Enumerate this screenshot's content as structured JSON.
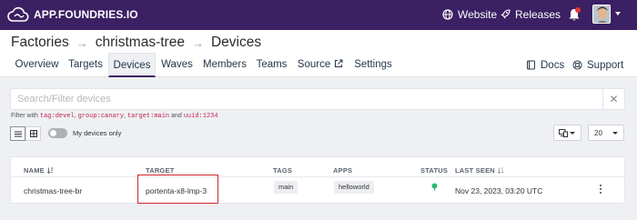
{
  "topbar": {
    "brand": "APP.FOUNDRIES.IO",
    "website_label": "Website",
    "releases_label": "Releases"
  },
  "breadcrumb": {
    "factories": "Factories",
    "factory": "christmas-tree",
    "current": "Devices"
  },
  "tabs": [
    "Overview",
    "Targets",
    "Devices",
    "Waves",
    "Members",
    "Teams",
    "Source",
    "Settings"
  ],
  "active_tab": "Devices",
  "header_links": {
    "docs": "Docs",
    "support": "Support"
  },
  "search": {
    "placeholder": "Search/Filter devices",
    "value": "",
    "clear": "✕"
  },
  "hint": {
    "prefix": "Filter with",
    "ex1": "tag:devel",
    "ex2": "group:canary",
    "ex3": "target:main",
    "and": "and",
    "ex4": "uuid:1234"
  },
  "toolbar": {
    "my_devices_label": "My devices only",
    "page_size": "20"
  },
  "table": {
    "columns": [
      "NAME",
      "TARGET",
      "TAGS",
      "APPS",
      "STATUS",
      "LAST SEEN"
    ],
    "rows": [
      {
        "name": "christmas-tree-br",
        "target": "portenta-x8-lmp-3",
        "tag": "main",
        "app": "helloworld",
        "status": "online",
        "last_seen": "Nov 23, 2023, 03:20 UTC"
      }
    ]
  },
  "colors": {
    "topbar": "#3b2063",
    "accent": "#3b2063",
    "highlight": "#d0242b",
    "status_online": "#2eb872"
  }
}
